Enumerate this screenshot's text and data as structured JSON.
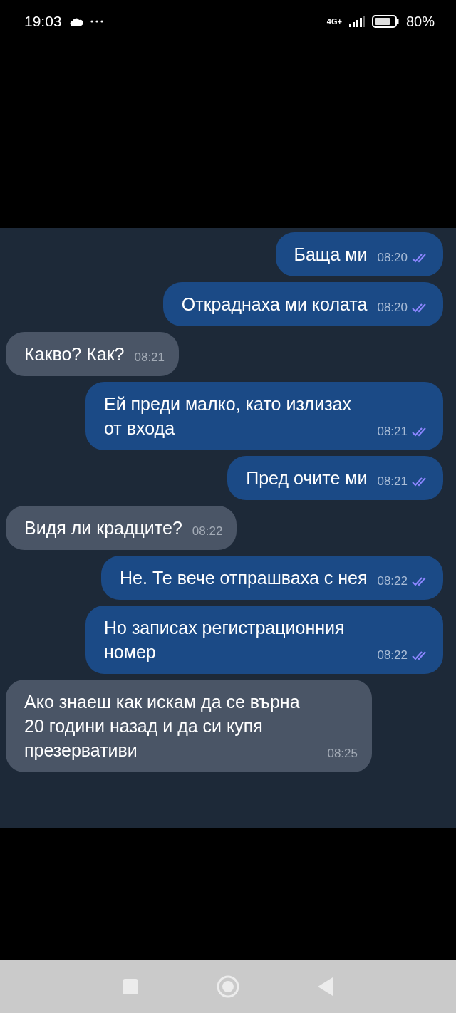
{
  "status_bar": {
    "time": "19:03",
    "network": "4G+",
    "battery": "80%"
  },
  "messages": [
    {
      "kind": "outgoing",
      "text": "Баща ми",
      "time": "08:20"
    },
    {
      "kind": "outgoing",
      "text": "Откраднаха ми колата",
      "time": "08:20"
    },
    {
      "kind": "incoming",
      "text": "Какво? Как?",
      "time": "08:21"
    },
    {
      "kind": "outgoing",
      "text": "Ей преди малко, като излизах от входа",
      "time": "08:21"
    },
    {
      "kind": "outgoing",
      "text": "Пред очите ми",
      "time": "08:21"
    },
    {
      "kind": "incoming",
      "text": "Видя ли крадците?",
      "time": "08:22"
    },
    {
      "kind": "outgoing",
      "text": "Не. Те вече отпрашваха с нея",
      "time": "08:22"
    },
    {
      "kind": "outgoing",
      "text": "Но записах регистрационния номер",
      "time": "08:22"
    },
    {
      "kind": "incoming",
      "text": "Ако знаеш как искам да се върна 20 години назад и да си купя презервативи",
      "time": "08:25"
    }
  ]
}
